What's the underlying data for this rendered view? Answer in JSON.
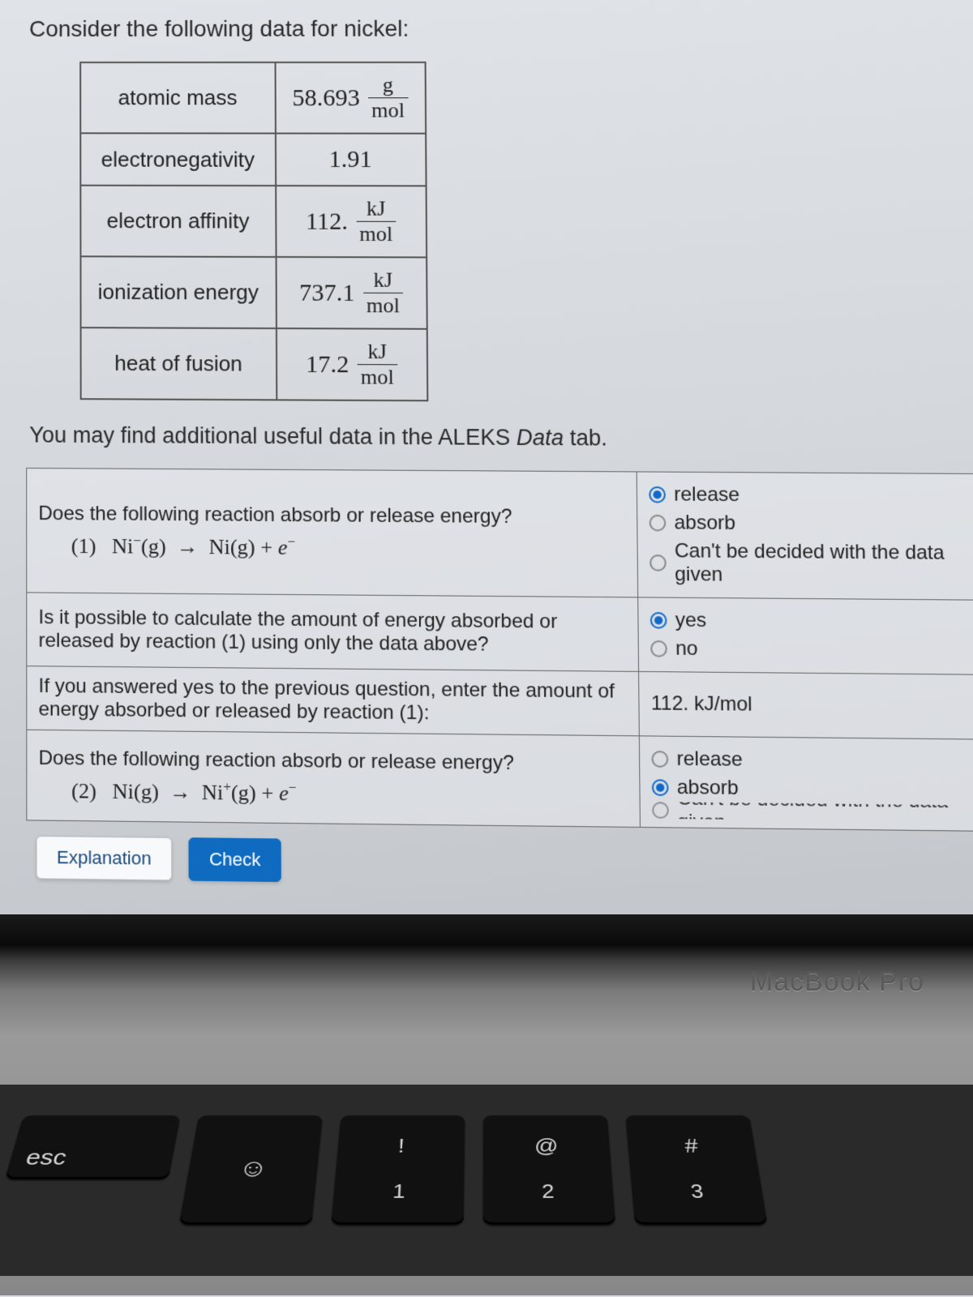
{
  "title": "Consider the following data for nickel:",
  "table_rows": [
    {
      "label": "atomic mass",
      "value": "58.693",
      "unit_num": "g",
      "unit_den": "mol"
    },
    {
      "label": "electronegativity",
      "value": "1.91",
      "unit_num": "",
      "unit_den": ""
    },
    {
      "label": "electron affinity",
      "value": "112.",
      "unit_num": "kJ",
      "unit_den": "mol"
    },
    {
      "label": "ionization energy",
      "value": "737.1",
      "unit_num": "kJ",
      "unit_den": "mol"
    },
    {
      "label": "heat of fusion",
      "value": "17.2",
      "unit_num": "kJ",
      "unit_den": "mol"
    }
  ],
  "hint_pre": "You may find additional useful data in the ALEKS ",
  "hint_ital": "Data",
  "hint_post": " tab.",
  "q1": {
    "prompt": "Does the following reaction absorb or release energy?",
    "eqn_label": "(1)   Ni⁻(g)  →  Ni(g) + e⁻",
    "opts": [
      "release",
      "absorb",
      "Can't be decided with the data given"
    ],
    "selected": 0
  },
  "q2": {
    "prompt": "Is it possible to calculate the amount of energy absorbed or released by reaction (1) using only the data above?",
    "opts": [
      "yes",
      "no"
    ],
    "selected": 0
  },
  "q3": {
    "prompt": "If you answered yes to the previous question, enter the amount of energy absorbed or released by reaction (1):",
    "value": "112. kJ/mol"
  },
  "q4": {
    "prompt": "Does the following reaction absorb or release energy?",
    "eqn_label": "(2)   Ni(g)  →  Ni⁺(g) + e⁻",
    "opts": [
      "release",
      "absorb",
      "Can't be decided with the data given"
    ],
    "selected": 1
  },
  "buttons": {
    "explain": "Explanation",
    "check": "Check"
  },
  "brand": "MacBook Pro",
  "keys": {
    "esc": "esc",
    "emoji": "☺",
    "k1_top": "!",
    "k1_bot": "1",
    "k2_top": "@",
    "k2_bot": "2",
    "k3_top": "#",
    "k3_bot": "3"
  }
}
